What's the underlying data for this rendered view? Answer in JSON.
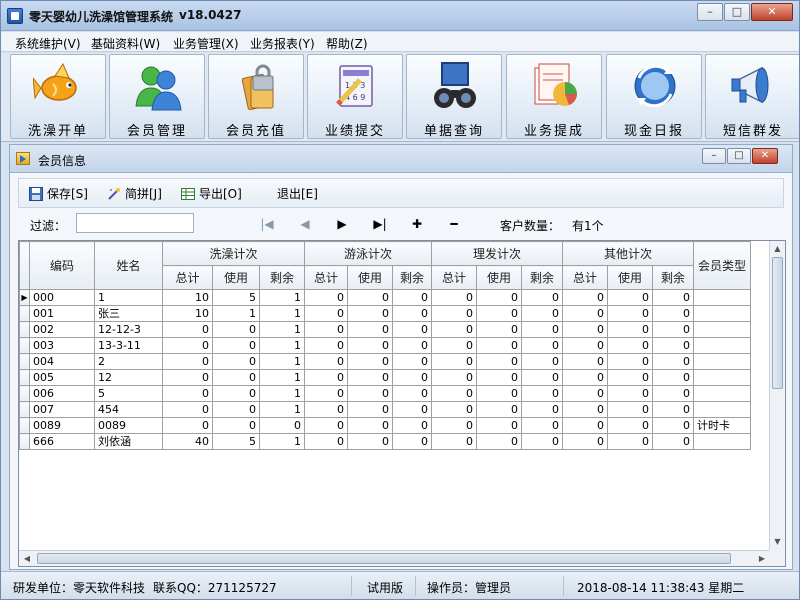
{
  "app": {
    "title": "零天婴幼儿洗澡馆管理系统",
    "version": "v18.0427"
  },
  "window_buttons": {
    "minimize": "–",
    "maximize": "□",
    "close": "✕"
  },
  "menu": [
    "系统维护(V)",
    "基础资料(W)",
    "业务管理(X)",
    "业务报表(Y)",
    "帮助(Z)"
  ],
  "toolbar": [
    {
      "label": "洗澡开单",
      "icon": "fish-icon"
    },
    {
      "label": "会员管理",
      "icon": "users-icon"
    },
    {
      "label": "会员充值",
      "icon": "card-lock-icon"
    },
    {
      "label": "业绩提交",
      "icon": "notepad-pencil-icon"
    },
    {
      "label": "单据查询",
      "icon": "binoculars-icon"
    },
    {
      "label": "业务提成",
      "icon": "pie-chart-icon"
    },
    {
      "label": "现金日报",
      "icon": "refresh-globe-icon"
    },
    {
      "label": "短信群发",
      "icon": "megaphone-icon"
    }
  ],
  "child_window": {
    "title": "会员信息",
    "actions": {
      "save": "保存[S]",
      "quick_pinyin": "简拼[J]",
      "export": "导出[O]",
      "exit": "退出[E]"
    },
    "filter": {
      "label": "过滤：",
      "value": ""
    },
    "nav": {
      "first": "|◀",
      "prev": "◀",
      "next": "▶",
      "last": "▶|",
      "add": "✚",
      "remove": "━"
    },
    "customer_count_label": "客户数量：",
    "customer_count_value": "有1个"
  },
  "grid": {
    "headers": {
      "code": "编码",
      "name": "姓名",
      "group_bath": "洗澡计次",
      "group_swim": "游泳计次",
      "group_hair": "理发计次",
      "group_other": "其他计次",
      "member_type": "会员类型",
      "sub_total": "总计",
      "sub_used": "使用",
      "sub_remain": "剩余"
    },
    "rows": [
      {
        "code": "000",
        "name": "1",
        "values": [
          "10",
          "5",
          "1",
          "0",
          "0",
          "0",
          "0",
          "0",
          "0",
          "0",
          "0",
          "0"
        ],
        "type": ""
      },
      {
        "code": "001",
        "name": "张三",
        "values": [
          "10",
          "1",
          "1",
          "0",
          "0",
          "0",
          "0",
          "0",
          "0",
          "0",
          "0",
          "0"
        ],
        "type": ""
      },
      {
        "code": "002",
        "name": "12-12-3",
        "values": [
          "0",
          "0",
          "1",
          "0",
          "0",
          "0",
          "0",
          "0",
          "0",
          "0",
          "0",
          "0"
        ],
        "type": ""
      },
      {
        "code": "003",
        "name": "13-3-11",
        "values": [
          "0",
          "0",
          "1",
          "0",
          "0",
          "0",
          "0",
          "0",
          "0",
          "0",
          "0",
          "0"
        ],
        "type": ""
      },
      {
        "code": "004",
        "name": "2",
        "values": [
          "0",
          "0",
          "1",
          "0",
          "0",
          "0",
          "0",
          "0",
          "0",
          "0",
          "0",
          "0"
        ],
        "type": ""
      },
      {
        "code": "005",
        "name": "12",
        "values": [
          "0",
          "0",
          "1",
          "0",
          "0",
          "0",
          "0",
          "0",
          "0",
          "0",
          "0",
          "0"
        ],
        "type": ""
      },
      {
        "code": "006",
        "name": "5",
        "values": [
          "0",
          "0",
          "1",
          "0",
          "0",
          "0",
          "0",
          "0",
          "0",
          "0",
          "0",
          "0"
        ],
        "type": ""
      },
      {
        "code": "007",
        "name": "454",
        "values": [
          "0",
          "0",
          "1",
          "0",
          "0",
          "0",
          "0",
          "0",
          "0",
          "0",
          "0",
          "0"
        ],
        "type": ""
      },
      {
        "code": "0089",
        "name": "0089",
        "values": [
          "0",
          "0",
          "0",
          "0",
          "0",
          "0",
          "0",
          "0",
          "0",
          "0",
          "0",
          "0"
        ],
        "type": "计时卡"
      },
      {
        "code": "666",
        "name": "刘依涵",
        "values": [
          "40",
          "5",
          "1",
          "0",
          "0",
          "0",
          "0",
          "0",
          "0",
          "0",
          "0",
          "0"
        ],
        "type": ""
      }
    ],
    "current_row_marker": "▶"
  },
  "status": {
    "developer": "研发单位：零天软件科技",
    "qq": "联系QQ：271125727",
    "edition": "试用版",
    "operator": "操作员：管理员",
    "datetime": "2018-08-14 11:38:43 星期二"
  },
  "colors": {
    "title_bar": "#b8cfe9",
    "close_button": "#c0422a",
    "window_bg": "#d6e2ef"
  }
}
